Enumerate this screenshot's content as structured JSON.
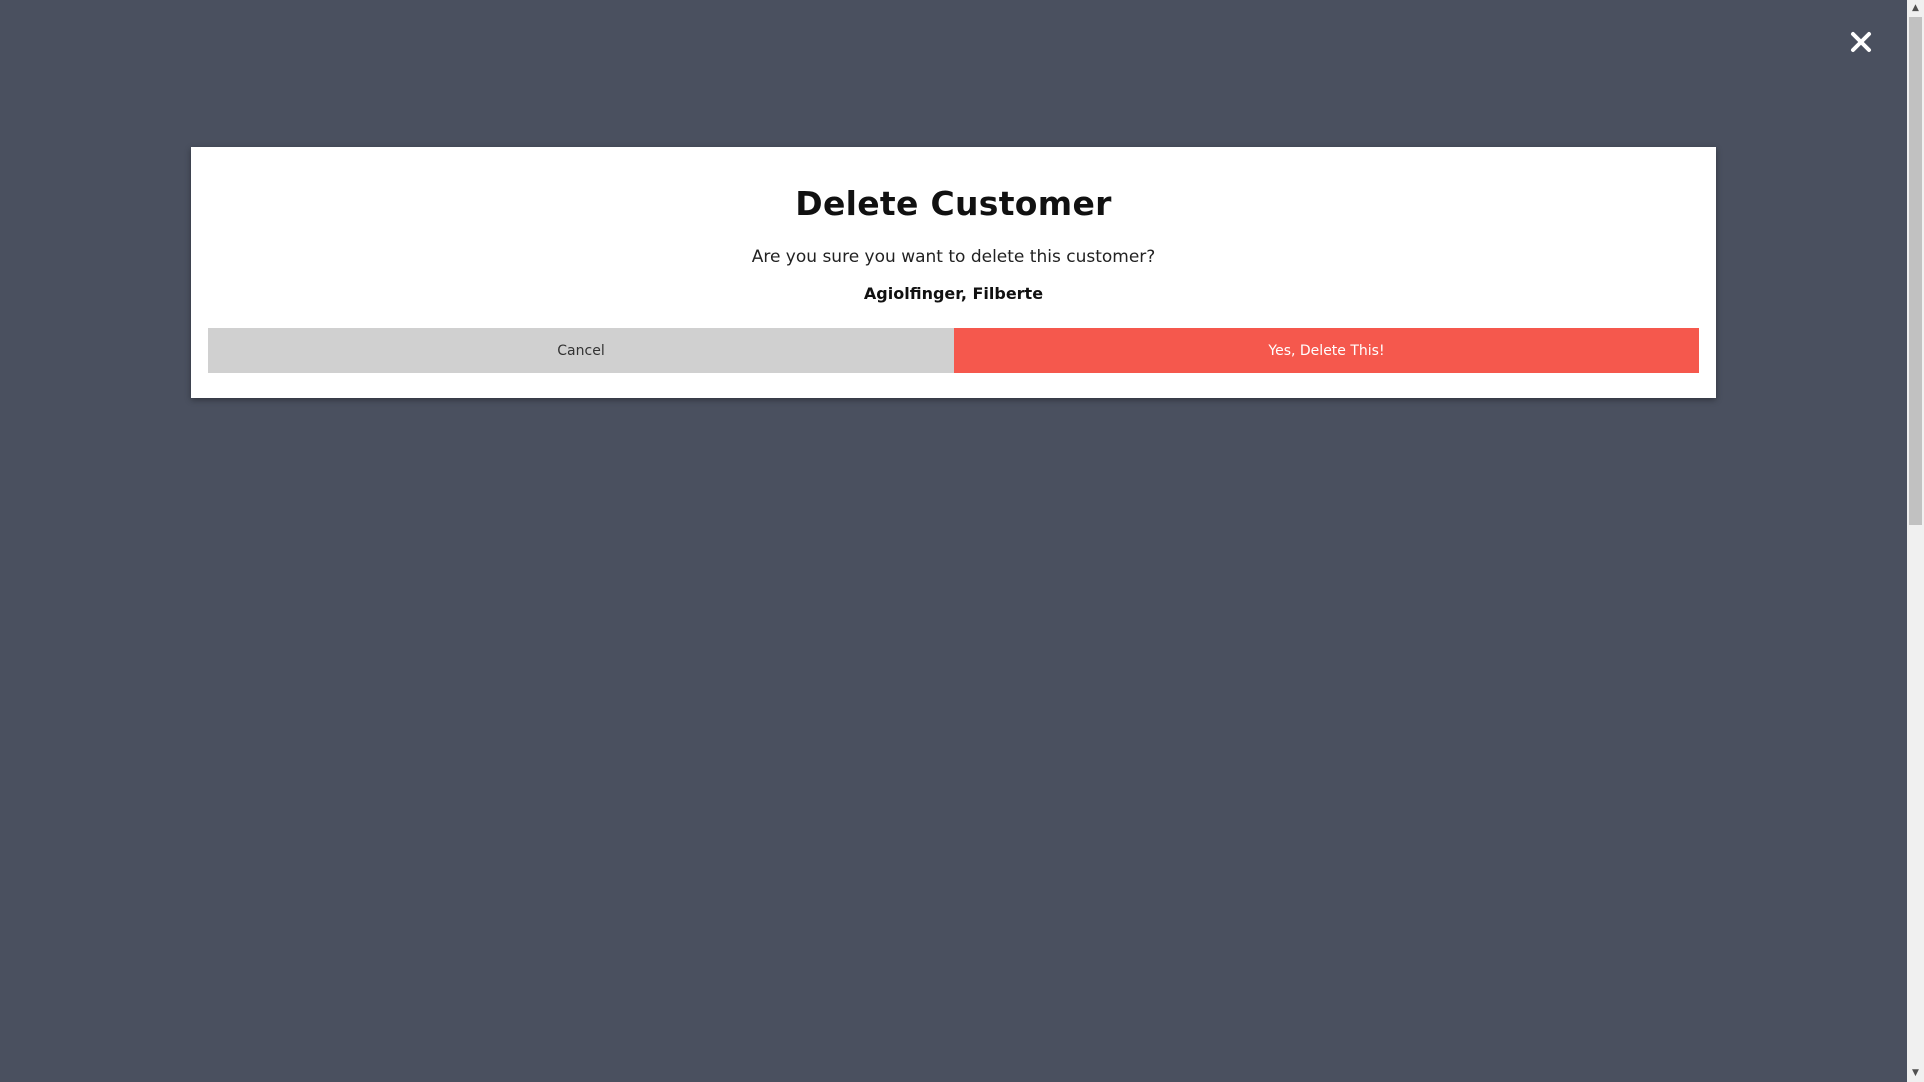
{
  "modal": {
    "title": "Delete Customer",
    "message": "Are you sure you want to delete this customer?",
    "customer_name": "Agiolfinger, Filberte",
    "cancel_label": "Cancel",
    "confirm_label": "Yes, Delete This!"
  },
  "icons": {
    "close": "close-icon",
    "scroll_up": "chevron-up-icon",
    "scroll_down": "chevron-down-icon"
  },
  "colors": {
    "overlay": "#4a505f",
    "modal_background": "#ffffff",
    "cancel_button": "#d0d0d0",
    "confirm_button": "#f5584d",
    "confirm_text": "#ffffff"
  }
}
